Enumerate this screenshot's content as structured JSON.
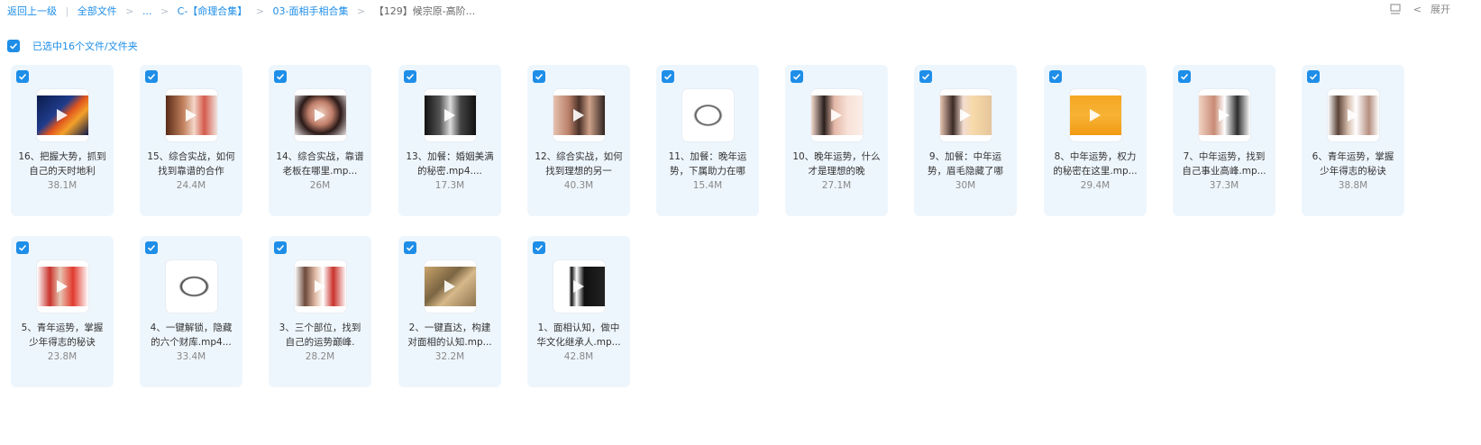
{
  "breadcrumb": {
    "back": "返回上一级",
    "all_files": "全部文件",
    "ellipsis": "...",
    "level1": "C-【命理合集】",
    "level2": "03-面相手相合集",
    "current": "【129】候宗原-高阶..."
  },
  "toolbar": {
    "expand_label": "展开"
  },
  "selection": {
    "text": "已选中16个文件/文件夹"
  },
  "files": [
    {
      "name": "16、把握大势，抓到自己的天时地利",
      "size": "38.1M",
      "thumb": "space"
    },
    {
      "name": "15、综合实战，如何找到靠谱的合作",
      "size": "24.4M",
      "thumb": "faces-warm"
    },
    {
      "name": "14、综合实战，靠谱老板在哪里.mp...",
      "size": "26M",
      "thumb": "girl"
    },
    {
      "name": "13、加餐：婚姻美满的秘密.mp4....",
      "size": "17.3M",
      "thumb": "bw-face"
    },
    {
      "name": "12、综合实战，如何找到理想的另一",
      "size": "40.3M",
      "thumb": "eyes"
    },
    {
      "name": "11、加餐：晚年运势，下属助力在哪",
      "size": "15.4M",
      "thumb": "sketch"
    },
    {
      "name": "10、晚年运势，什么才是理想的晚",
      "size": "27.1M",
      "thumb": "woman-neck"
    },
    {
      "name": "9、加餐：中年运势，眉毛隐藏了哪",
      "size": "30M",
      "thumb": "woman-eye"
    },
    {
      "name": "8、中年运势，权力的秘密在这里.mp...",
      "size": "29.4M",
      "thumb": "orange-slide"
    },
    {
      "name": "7、中年运势，找到自己事业高峰.mp...",
      "size": "37.3M",
      "thumb": "woman-man"
    },
    {
      "name": "6、青年运势，掌握少年得志的秘诀",
      "size": "38.8M",
      "thumb": "old-men"
    },
    {
      "name": "5、青年运势，掌握少年得志的秘诀",
      "size": "23.8M",
      "thumb": "old-man-red"
    },
    {
      "name": "4、一键解锁，隐藏的六个财库.mp4...",
      "size": "33.4M",
      "thumb": "sketch2"
    },
    {
      "name": "3、三个部位，找到自己的运势巅峰.",
      "size": "28.2M",
      "thumb": "two-men"
    },
    {
      "name": "2、一键直达，构建对面相的认知.mp...",
      "size": "32.2M",
      "thumb": "map"
    },
    {
      "name": "1、面相认知，做中华文化继承人.mp...",
      "size": "42.8M",
      "thumb": "calligraphy"
    }
  ],
  "colors": {
    "accent": "#1e8ee8",
    "card_bg": "#eef6fd"
  }
}
